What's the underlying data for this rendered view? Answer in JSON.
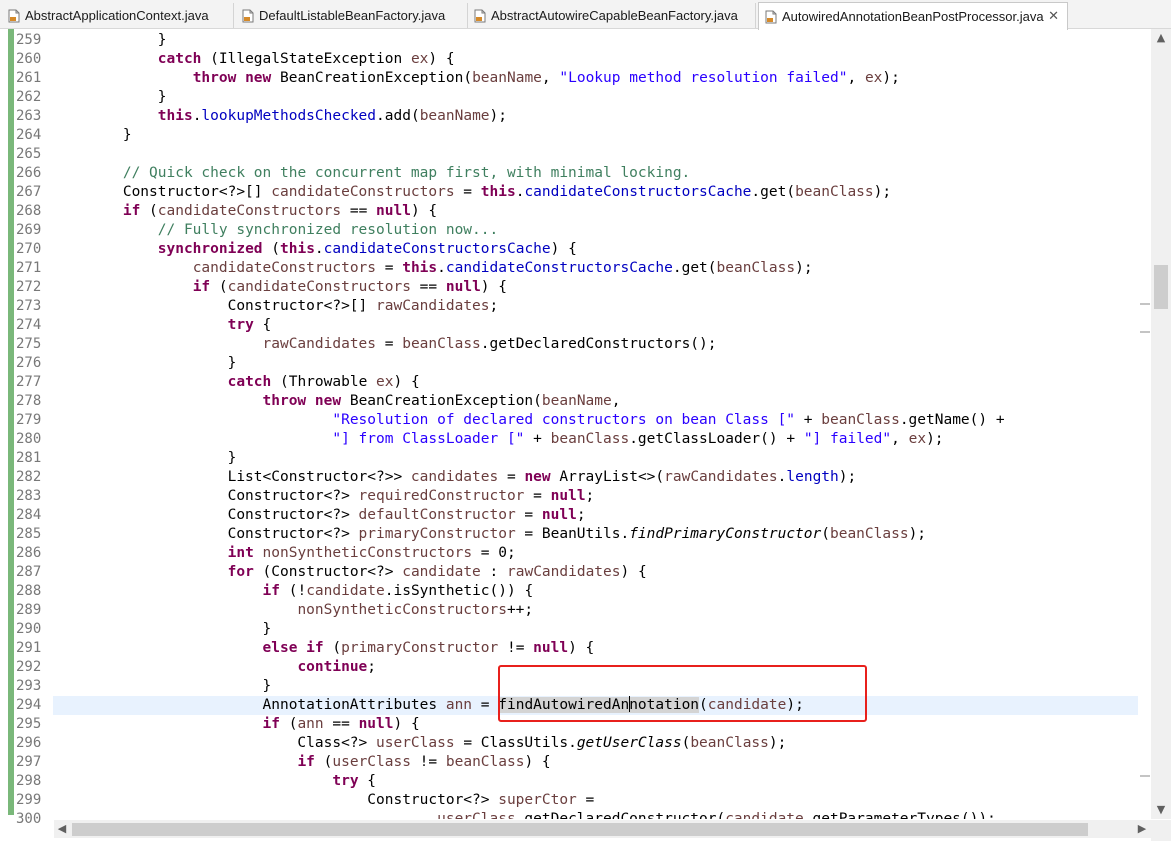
{
  "tabs": [
    {
      "label": "AbstractApplicationContext.java",
      "active": false
    },
    {
      "label": "DefaultListableBeanFactory.java",
      "active": false
    },
    {
      "label": "AbstractAutowireCapableBeanFactory.java",
      "active": false
    },
    {
      "label": "AutowiredAnnotationBeanPostProcessor.java",
      "active": true
    }
  ],
  "tab_close_glyph": "✕",
  "line_numbers": [
    "259",
    "260",
    "261",
    "262",
    "263",
    "264",
    "265",
    "266",
    "267",
    "268",
    "269",
    "270",
    "271",
    "272",
    "273",
    "274",
    "275",
    "276",
    "277",
    "278",
    "279",
    "280",
    "281",
    "282",
    "283",
    "284",
    "285",
    "286",
    "287",
    "288",
    "289",
    "290",
    "291",
    "292",
    "293",
    "294",
    "295",
    "296",
    "297",
    "298",
    "299",
    "300"
  ],
  "current_line": "294",
  "code_lines": [
    "            }",
    "            catch (IllegalStateException ex) {",
    "                throw new BeanCreationException(beanName, \"Lookup method resolution failed\", ex);",
    "            }",
    "            this.lookupMethodsChecked.add(beanName);",
    "        }",
    "",
    "        // Quick check on the concurrent map first, with minimal locking.",
    "        Constructor<?>[] candidateConstructors = this.candidateConstructorsCache.get(beanClass);",
    "        if (candidateConstructors == null) {",
    "            // Fully synchronized resolution now...",
    "            synchronized (this.candidateConstructorsCache) {",
    "                candidateConstructors = this.candidateConstructorsCache.get(beanClass);",
    "                if (candidateConstructors == null) {",
    "                    Constructor<?>[] rawCandidates;",
    "                    try {",
    "                        rawCandidates = beanClass.getDeclaredConstructors();",
    "                    }",
    "                    catch (Throwable ex) {",
    "                        throw new BeanCreationException(beanName,",
    "                                \"Resolution of declared constructors on bean Class [\" + beanClass.getName() +",
    "                                \"] from ClassLoader [\" + beanClass.getClassLoader() + \"] failed\", ex);",
    "                    }",
    "                    List<Constructor<?>> candidates = new ArrayList<>(rawCandidates.length);",
    "                    Constructor<?> requiredConstructor = null;",
    "                    Constructor<?> defaultConstructor = null;",
    "                    Constructor<?> primaryConstructor = BeanUtils.findPrimaryConstructor(beanClass);",
    "                    int nonSyntheticConstructors = 0;",
    "                    for (Constructor<?> candidate : rawCandidates) {",
    "                        if (!candidate.isSynthetic()) {",
    "                            nonSyntheticConstructors++;",
    "                        }",
    "                        else if (primaryConstructor != null) {",
    "                            continue;",
    "                        }",
    "                        AnnotationAttributes ann = findAutowiredAnnotation(candidate);",
    "                        if (ann == null) {",
    "                            Class<?> userClass = ClassUtils.getUserClass(beanClass);",
    "                            if (userClass != beanClass) {",
    "                                try {",
    "                                    Constructor<?> superCtor =",
    "                                            userClass.getDeclaredConstructor(candidate.getParameterTypes());"
  ],
  "highlighted_symbol": "findAutowiredAnnotation",
  "colors": {
    "keyword": "#7f0055",
    "string": "#2a00ff",
    "comment": "#3f7f5f",
    "field": "#0000c0",
    "local_variable": "#6a3e3e",
    "annotation_box": "#e8201c",
    "current_line_bg": "#e8f2fe",
    "change_bar": "#7ab87a"
  },
  "icons": {
    "tab_file": "java-file-icon",
    "scroll_up": "scroll-up-arrow-icon",
    "scroll_down": "scroll-down-arrow-icon",
    "scroll_left": "scroll-left-arrow-icon",
    "scroll_right": "scroll-right-arrow-icon"
  },
  "scroll_glyphs": {
    "up": "▲",
    "down": "▼",
    "left": "◀",
    "right": "▶"
  }
}
